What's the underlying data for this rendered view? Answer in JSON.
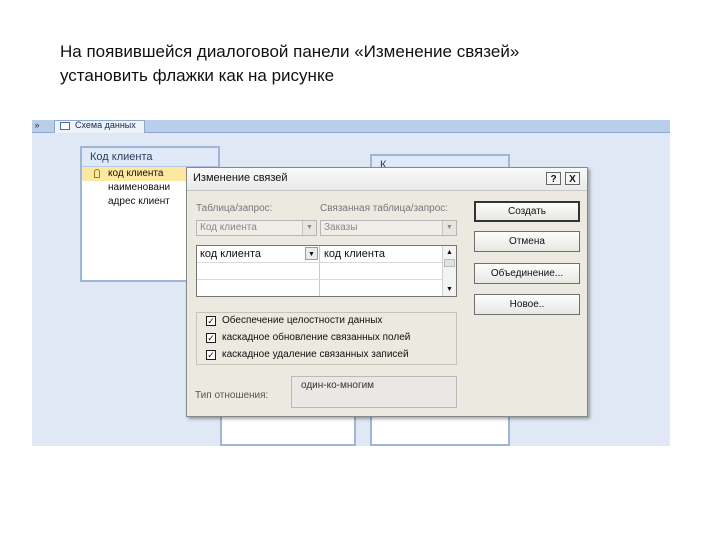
{
  "heading": {
    "line1": "На появившейся диалоговой панели «Изменение связей»",
    "line2": "установить флажки как на рисунке"
  },
  "access": {
    "tab_label": "Схема данных",
    "tab_control": "»",
    "table1": {
      "title": "Код клиента",
      "fields": [
        "код клиента",
        "наименовани",
        "адрес клиент"
      ]
    },
    "table2": {
      "title": "К"
    }
  },
  "dialog": {
    "title": "Изменение связей",
    "help_button": "?",
    "close_button": "X",
    "table_label": "Таблица/запрос:",
    "related_label": "Связанная таблица/запрос:",
    "table_value": "Код клиента",
    "related_value": "Заказы",
    "grid": {
      "left_field": "код клиента",
      "right_field": "код клиента"
    },
    "options": [
      {
        "label": "Обеспечение целостности данных",
        "checked": true
      },
      {
        "label": "каскадное обновление связанных полей",
        "checked": true
      },
      {
        "label": "каскадное удаление связанных записей",
        "checked": true
      }
    ],
    "check_mark": "✓",
    "relation_type_label": "Тип отношения:",
    "relation_type_value": "один-ко-многим",
    "buttons": {
      "create": "Создать",
      "cancel": "Отмена",
      "join": "Объединение...",
      "new": "Новое.."
    }
  },
  "icons": {
    "dropdown": "▼",
    "scroll_up": "▲",
    "scroll_down": "▼"
  },
  "colors": {
    "selected_field": "#fde8a2",
    "dialog_bg": "#ece9e0",
    "workspace_bg": "#dfe8f4"
  }
}
